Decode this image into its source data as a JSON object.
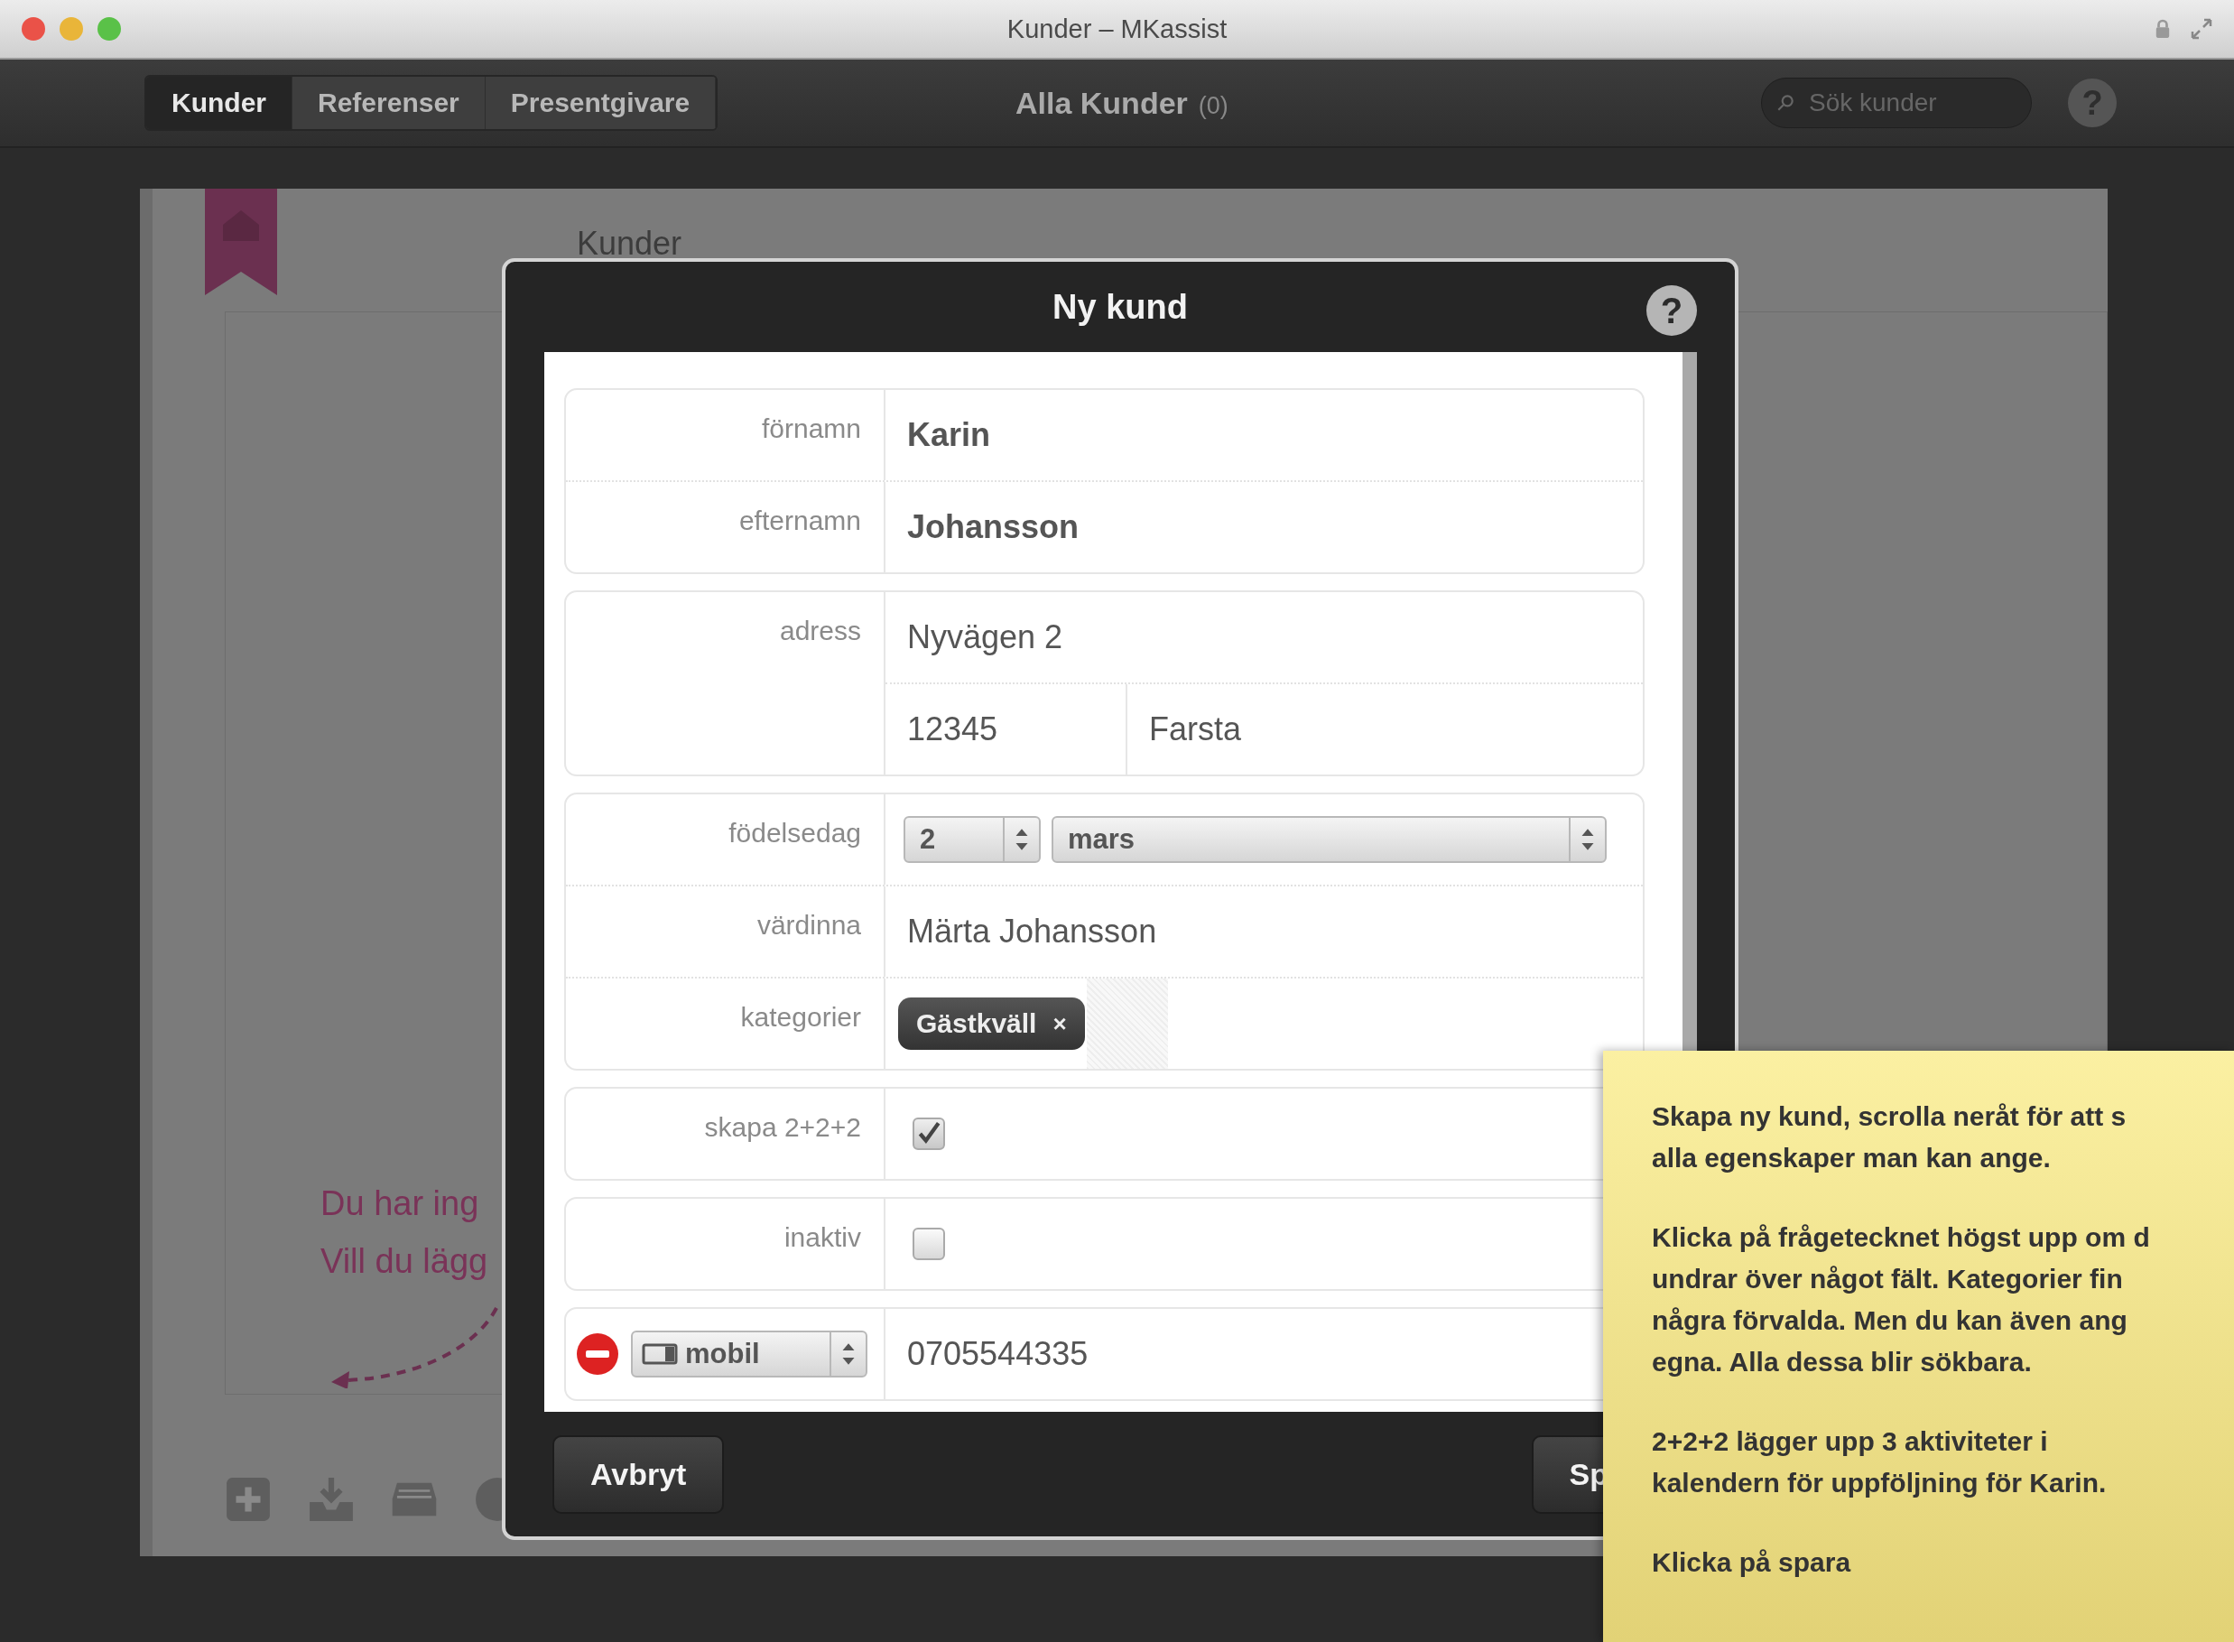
{
  "window": {
    "title": "Kunder – MKassist"
  },
  "toolbar": {
    "tabs": [
      {
        "label": "Kunder",
        "selected": true
      },
      {
        "label": "Referenser",
        "selected": false
      },
      {
        "label": "Presentgivare",
        "selected": false
      }
    ],
    "heading": "Alla Kunder",
    "count": "(0)",
    "search": {
      "placeholder": "Sök kunder"
    },
    "help": "?"
  },
  "background": {
    "heading": "Kunder",
    "hint_lines": [
      "Du har ing",
      "Vill du lägg"
    ]
  },
  "dialog": {
    "title": "Ny kund",
    "help": "?",
    "groups": [
      [
        {
          "kind": "text",
          "label": "förnamn",
          "value": "Karin",
          "bold": true
        },
        {
          "kind": "text",
          "label": "efternamn",
          "value": "Johansson",
          "bold": true
        }
      ],
      [
        {
          "kind": "address",
          "label": "adress",
          "street": "Nyvägen 2",
          "zip": "12345",
          "city": "Farsta"
        }
      ],
      [
        {
          "kind": "date",
          "label": "födelsedag",
          "day": "2",
          "month": "mars"
        },
        {
          "kind": "text",
          "label": "värdinna",
          "value": "Märta Johansson",
          "bold": false
        },
        {
          "kind": "tags",
          "label": "kategorier",
          "tags": [
            {
              "label": "Gästkväll",
              "remove": "×"
            }
          ]
        }
      ],
      [
        {
          "kind": "checkbox",
          "label": "skapa 2+2+2",
          "checked": true
        }
      ],
      [
        {
          "kind": "checkbox",
          "label": "inaktiv",
          "checked": false
        }
      ],
      [
        {
          "kind": "phone",
          "type": "mobil",
          "value": "0705544335"
        }
      ]
    ],
    "buttons": [
      "Avbryt",
      "Sp"
    ]
  },
  "note": {
    "paragraphs": [
      [
        "Skapa ny kund, scrolla neråt för att s",
        "alla egenskaper man kan ange."
      ],
      [
        "Klicka på frågetecknet högst upp om d",
        "undrar över något fält. Kategorier fin",
        "några förvalda. Men du kan även ang",
        "egna. Alla dessa blir sökbara."
      ],
      [
        "2+2+2 lägger upp 3 aktiviteter i",
        "kalendern för uppföljning för Karin."
      ],
      [
        "Klicka på spara"
      ]
    ]
  }
}
